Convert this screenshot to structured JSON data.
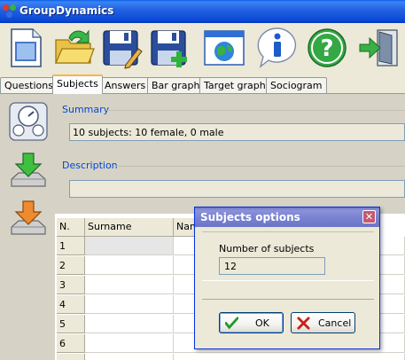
{
  "window": {
    "title": "GroupDynamics"
  },
  "toolbar": {
    "buttons": [
      {
        "name": "new-file-icon"
      },
      {
        "name": "open-folder-icon"
      },
      {
        "name": "save-edit-icon"
      },
      {
        "name": "save-add-icon"
      },
      {
        "name": "browser-window-icon"
      },
      {
        "name": "info-icon"
      },
      {
        "name": "help-icon"
      },
      {
        "name": "exit-door-icon"
      }
    ]
  },
  "tabs": [
    "Questions",
    "Subjects",
    "Answers",
    "Bar graph",
    "Target graph",
    "Sociogram"
  ],
  "active_tab": "Subjects",
  "summary": {
    "label": "Summary",
    "value": "10 subjects: 10 female, 0 male"
  },
  "description": {
    "label": "Description",
    "value": ""
  },
  "grid": {
    "headers": [
      "N.",
      "Surname",
      "Nam"
    ],
    "rows": [
      "1",
      "2",
      "3",
      "4",
      "5",
      "6"
    ]
  },
  "dialog": {
    "title": "Subjects options",
    "field_label": "Number of subjects",
    "field_value": "12",
    "ok_label": "OK",
    "cancel_label": "Cancel"
  },
  "colors": {
    "titlebar": "#0a48d6",
    "dialog_title": "#7983d2",
    "label_blue": "#0046d5"
  }
}
